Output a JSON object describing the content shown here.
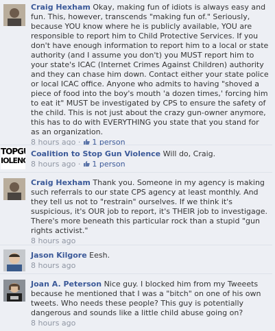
{
  "comments": [
    {
      "author": "Craig Hexham",
      "text": "Okay, making fun of idiots is always easy and fun. This, however, transcends \"making fun of.\" Seriously, because YOU know where he is publicly available, YOU are responsible to report him to Child Protective Services. If you don't have enough information to report him to a local or state authority (and I assume you don't) you MUST report him to your state's ICAC (Internet Crimes Against Children) authority and they can chase him down. Contact either your state police or local ICAC office. Anyone who admits to having \"shoved a piece of food into the boy's mouth 'a dozen times,' forcing him to eat it\" MUST be investigated by CPS to ensure the safety of the child. This is not just about the crazy gun-owner anymore, this has to do with EVERYTHING you state that you stand for as an organization.",
      "time": "8 hours ago",
      "likes": "1 person"
    },
    {
      "author": "Coalition to Stop Gun Violence",
      "text": "Will do, Craig.",
      "time": "8 hours ago",
      "likes": "1 person",
      "avatar_text": [
        "TOPGU",
        "IOLENC"
      ]
    },
    {
      "author": "Craig Hexham",
      "text": "Thank you. Someone in my agency is making such referrals to our state CPS agency at least monthly. And they tell us not to \"restrain\" ourselves. If we think it's suspicious, it's OUR job to report, it's THEIR job to investigage. There's more beneath this particular rock than a stupid \"gun rights activist.\"",
      "time": "8 hours ago"
    },
    {
      "author": "Jason Kilgore",
      "text": "Eesh.",
      "time": "8 hours ago"
    },
    {
      "author": "Joan A. Peterson",
      "text": "Nice guy. I blocked him from my Tweeets because he mentioned that I was a \"bitch\" on one of his own tweets. Who needs these people? This guy is potentially dangerous and sounds like a little child abuse going on?",
      "time": "8 hours ago"
    }
  ],
  "separator": "·",
  "colors": {
    "link": "#3b5998",
    "background": "#edeff4",
    "meta": "#8f96a3"
  },
  "icons": {
    "like": "thumbs-up-icon"
  }
}
